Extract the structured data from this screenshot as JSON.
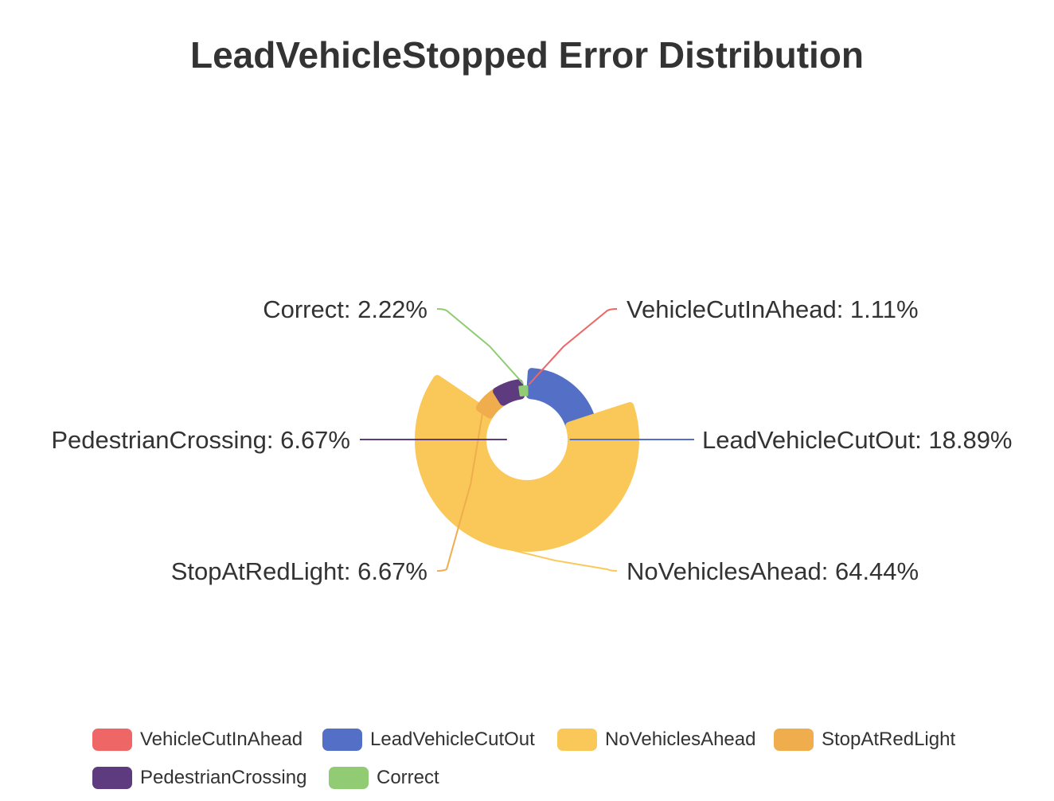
{
  "chart_data": {
    "type": "pie",
    "variant": "rose-radius",
    "title": "LeadVehicleStopped Error Distribution",
    "legend_position": "bottom",
    "label_format": "{name}: {percent}%",
    "slices": [
      {
        "name": "VehicleCutInAhead",
        "percent": 1.11,
        "color": "#ee6666"
      },
      {
        "name": "LeadVehicleCutOut",
        "percent": 18.89,
        "color": "#5470c6"
      },
      {
        "name": "NoVehiclesAhead",
        "percent": 64.44,
        "color": "#fac858"
      },
      {
        "name": "StopAtRedLight",
        "percent": 6.67,
        "color": "#f0ad4e"
      },
      {
        "name": "PedestrianCrossing",
        "percent": 6.67,
        "color": "#5e3a7e"
      },
      {
        "name": "Correct",
        "percent": 2.22,
        "color": "#91cc75"
      }
    ]
  }
}
